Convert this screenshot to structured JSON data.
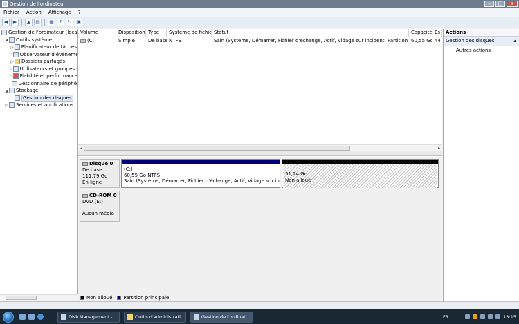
{
  "window": {
    "title": "Gestion de l'ordinateur",
    "btn_min": "–",
    "btn_max": "□",
    "btn_close": "x"
  },
  "menu": [
    "Fichier",
    "Action",
    "Affichage",
    "?"
  ],
  "toolbar_icons": [
    "back-arrow-icon",
    "forward-arrow-icon",
    "up-folder-icon",
    "show-tree-icon",
    "properties-icon",
    "help-icon",
    "refresh-icon",
    "export-icon"
  ],
  "tree": [
    {
      "label": "Gestion de l'ordinateur (local)",
      "level": 0,
      "exp": ""
    },
    {
      "label": "Outils système",
      "level": 1,
      "exp": "◢"
    },
    {
      "label": "Planificateur de tâches",
      "level": 2,
      "exp": "▷"
    },
    {
      "label": "Observateur d'événeme",
      "level": 2,
      "exp": "▷"
    },
    {
      "label": "Dossiers partagés",
      "level": 2,
      "exp": "▷"
    },
    {
      "label": "Utilisateurs et groupes l",
      "level": 2,
      "exp": "▷"
    },
    {
      "label": "Fiabilité et performance",
      "level": 2,
      "exp": "▷"
    },
    {
      "label": "Gestionnaire de périphé",
      "level": 2,
      "exp": ""
    },
    {
      "label": "Stockage",
      "level": 1,
      "exp": "◢"
    },
    {
      "label": "Gestion des disques",
      "level": 2,
      "exp": "",
      "selected": true
    },
    {
      "label": "Services et applications",
      "level": 1,
      "exp": "▷"
    }
  ],
  "volumes": {
    "headers": [
      "Volume",
      "Disposition",
      "Type",
      "Système de fichiers",
      "Statut",
      "Capacité",
      "Es"
    ],
    "rows": [
      [
        "(C:)",
        "Simple",
        "De base",
        "NTFS",
        "Sain (Système, Démarrer, Fichier d'échange, Actif, Vidage sur incident, Partition principale)",
        "60,55 Go",
        "44"
      ]
    ]
  },
  "disks": [
    {
      "name": "Disque 0",
      "type": "De base",
      "size": "111,79 Go",
      "state": "En ligne",
      "partitions": [
        {
          "label": "(C:)",
          "size": "60,55 Go NTFS",
          "status": "Sain (Système, Démarrer, Fichier d'échange, Actif, Vidage sur incident, P",
          "kind": "primary"
        },
        {
          "label": "",
          "size": "51,24 Go",
          "status": "Non alloué",
          "kind": "unallocated"
        }
      ]
    },
    {
      "name": "CD-ROM 0",
      "type": "DVD (E:)",
      "size": "",
      "state": "Aucun média"
    }
  ],
  "legend": [
    {
      "label": "Non alloué",
      "color": "#000000"
    },
    {
      "label": "Partition principale",
      "color": "#00007a"
    }
  ],
  "actions": {
    "header": "Actions",
    "section": "Gestion des disques",
    "item": "Autres actions"
  },
  "taskbar": {
    "tasks": [
      "Disk Management - ...",
      "Outils d'administrati...",
      "Gestion de l'ordinat..."
    ],
    "lang": "FR",
    "clock": "13:15"
  }
}
